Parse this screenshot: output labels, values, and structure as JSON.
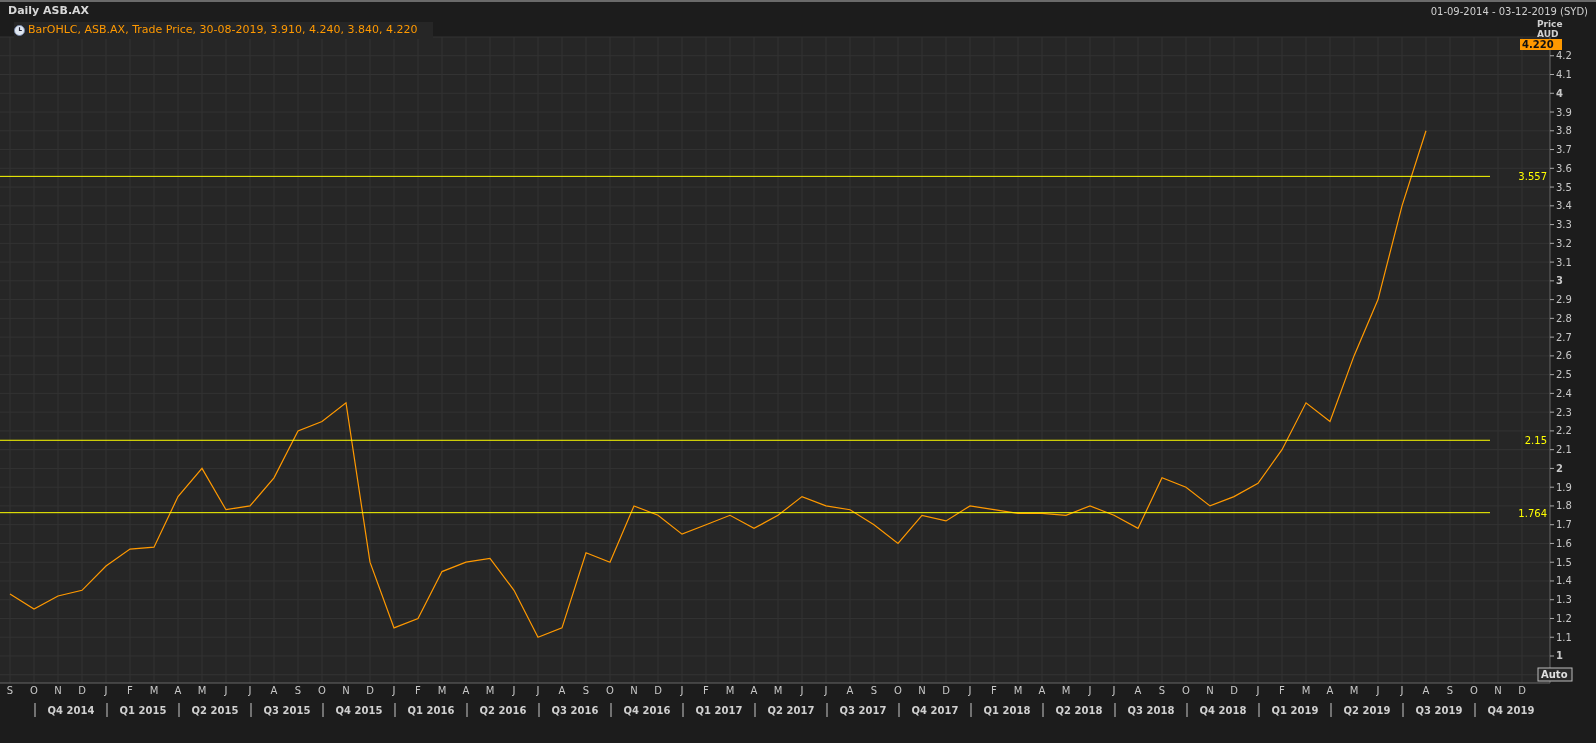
{
  "window": {
    "title": "Daily ASB.AX",
    "date_range": "01-09-2014 - 03-12-2019 (SYD)"
  },
  "legend": "BarOHLC, ASB.AX, Trade Price, 30-08-2019, 3.910, 4.240, 3.840, 4.220",
  "price_axis": {
    "title": "Price",
    "unit": "AUD",
    "last_price": "4.220",
    "auto_button": "Auto"
  },
  "chart_data": {
    "type": "line",
    "ylim": [
      0.856,
      4.3
    ],
    "grid": true,
    "yticks": [
      1,
      1.1,
      1.2,
      1.3,
      1.4,
      1.5,
      1.6,
      1.7,
      1.8,
      1.9,
      2,
      2.1,
      2.2,
      2.3,
      2.4,
      2.5,
      2.6,
      2.7,
      2.8,
      2.9,
      3,
      3.1,
      3.2,
      3.3,
      3.4,
      3.5,
      3.6,
      3.7,
      3.8,
      3.9,
      4,
      4.1,
      4.2
    ],
    "categories": [
      "S",
      "O",
      "N",
      "D",
      "J",
      "F",
      "M",
      "A",
      "M",
      "J",
      "J",
      "A",
      "S",
      "O",
      "N",
      "D",
      "J",
      "F",
      "M",
      "A",
      "M",
      "J",
      "J",
      "A",
      "S",
      "O",
      "N",
      "D",
      "J",
      "F",
      "M",
      "A",
      "M",
      "J",
      "J",
      "A",
      "S",
      "O",
      "N",
      "D",
      "J",
      "F",
      "M",
      "A",
      "M",
      "J",
      "J",
      "A",
      "S",
      "O",
      "N",
      "D",
      "J",
      "F",
      "M",
      "A",
      "M",
      "J",
      "J",
      "A",
      "S",
      "O",
      "N",
      "D"
    ],
    "series": [
      {
        "color": "#ff9900",
        "values": [
          1.33,
          1.25,
          1.32,
          1.35,
          1.48,
          1.57,
          1.58,
          1.85,
          2.0,
          1.78,
          1.8,
          1.95,
          2.2,
          2.25,
          2.35,
          1.5,
          1.15,
          1.2,
          1.45,
          1.5,
          1.52,
          1.35,
          1.1,
          1.15,
          1.55,
          1.5,
          1.8,
          1.75,
          1.65,
          1.7,
          1.75,
          1.68,
          1.75,
          1.85,
          1.8,
          1.78,
          1.7,
          1.6,
          1.75,
          1.72,
          1.8,
          1.78,
          1.76,
          1.76,
          1.75,
          1.8,
          1.75,
          1.68,
          1.95,
          1.9,
          1.8,
          1.85,
          1.92,
          2.1,
          2.35,
          2.25,
          2.6,
          2.9,
          3.4,
          3.8,
          null,
          null,
          null,
          null
        ]
      }
    ],
    "ref_lines": [
      {
        "axis": "y",
        "value": 3.557,
        "label": "3.557"
      },
      {
        "axis": "y",
        "value": 2.15,
        "label": "2.15"
      },
      {
        "axis": "y",
        "value": 1.764,
        "label": "1.764"
      }
    ]
  },
  "quarters": [
    "Q4 2014",
    "Q1 2015",
    "Q2 2015",
    "Q3 2015",
    "Q4 2015",
    "Q1 2016",
    "Q2 2016",
    "Q3 2016",
    "Q4 2016",
    "Q1 2017",
    "Q2 2017",
    "Q3 2017",
    "Q4 2017",
    "Q1 2018",
    "Q2 2018",
    "Q3 2018",
    "Q4 2018",
    "Q1 2019",
    "Q2 2019",
    "Q3 2019",
    "Q4 2019"
  ]
}
